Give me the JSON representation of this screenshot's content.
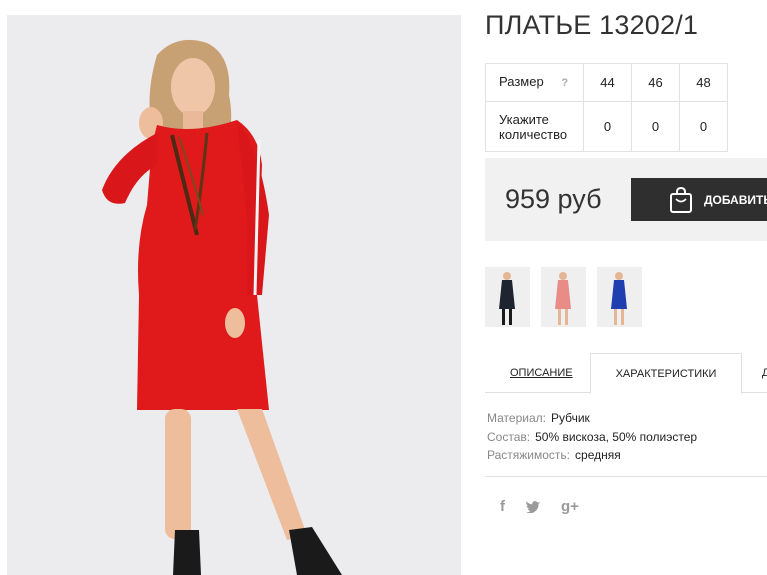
{
  "product": {
    "title": "ПЛАТЬЕ 13202/1",
    "price": "959 руб",
    "add_button_label": "ДОБАВИТЬ"
  },
  "sizes": {
    "size_label": "Размер",
    "help_symbol": "?",
    "qty_label": "Укажите количество",
    "values": [
      "44",
      "46",
      "48"
    ],
    "quantities": [
      "0",
      "0",
      "0"
    ]
  },
  "thumbnails": [
    {
      "alt": "navy dress",
      "color": "#1f2530"
    },
    {
      "alt": "pink dress",
      "color": "#e98c88"
    },
    {
      "alt": "blue dress",
      "color": "#1f3fb0"
    }
  ],
  "tabs": {
    "description": "ОПИСАНИЕ",
    "characteristics": "ХАРАКТЕРИСТИКИ",
    "more": "Д"
  },
  "specs": [
    {
      "key": "Материал:",
      "value": "Рубчик"
    },
    {
      "key": "Состав:",
      "value": "50% вискоза, 50% полиэстер"
    },
    {
      "key": "Растяжимость:",
      "value": "средняя"
    }
  ],
  "social": {
    "facebook": "f",
    "google_plus": "g+"
  },
  "colors": {
    "dress_red": "#e0191b",
    "button_dark": "#2f2f2f",
    "price_bg": "#f1f1f1"
  }
}
